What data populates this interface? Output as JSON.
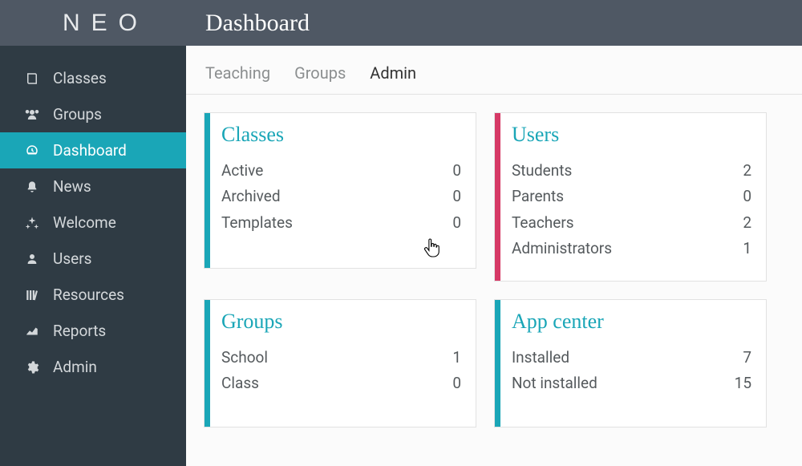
{
  "logo_text": "NEO",
  "sidebar": {
    "items": [
      {
        "label": "Classes"
      },
      {
        "label": "Groups"
      },
      {
        "label": "Dashboard"
      },
      {
        "label": "News"
      },
      {
        "label": "Welcome"
      },
      {
        "label": "Users"
      },
      {
        "label": "Resources"
      },
      {
        "label": "Reports"
      },
      {
        "label": "Admin"
      }
    ]
  },
  "header": {
    "title": "Dashboard"
  },
  "tabs": [
    {
      "label": "Teaching"
    },
    {
      "label": "Groups"
    },
    {
      "label": "Admin"
    }
  ],
  "cards": {
    "classes": {
      "title": "Classes",
      "accent": "#1aa6b7",
      "rows": [
        {
          "label": "Active",
          "value": "0"
        },
        {
          "label": "Archived",
          "value": "0"
        },
        {
          "label": "Templates",
          "value": "0"
        }
      ]
    },
    "users": {
      "title": "Users",
      "accent": "#d63966",
      "rows": [
        {
          "label": "Students",
          "value": "2"
        },
        {
          "label": "Parents",
          "value": "0"
        },
        {
          "label": "Teachers",
          "value": "2"
        },
        {
          "label": "Administrators",
          "value": "1"
        }
      ]
    },
    "groups": {
      "title": "Groups",
      "accent": "#1aa6b7",
      "rows": [
        {
          "label": "School",
          "value": "1"
        },
        {
          "label": "Class",
          "value": "0"
        }
      ]
    },
    "appcenter": {
      "title": "App center",
      "accent": "#1aa6b7",
      "rows": [
        {
          "label": "Installed",
          "value": "7"
        },
        {
          "label": "Not installed",
          "value": "15"
        }
      ]
    }
  }
}
